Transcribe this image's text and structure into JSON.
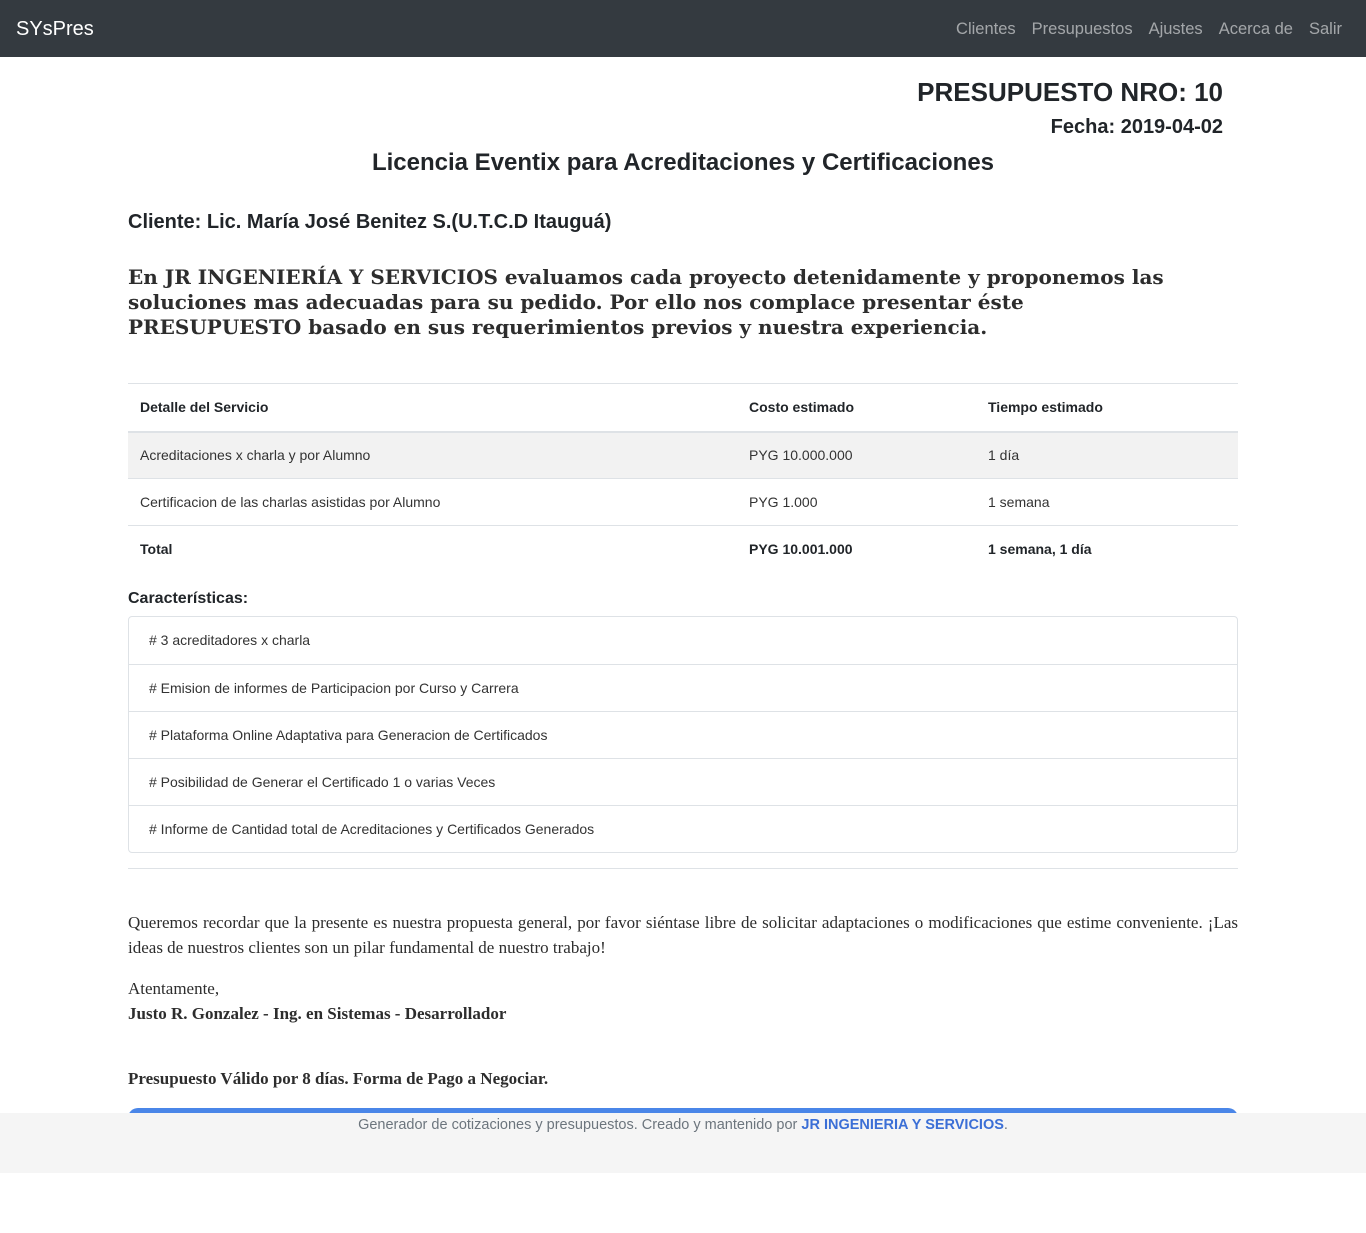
{
  "navbar": {
    "brand": "SYsPres",
    "items": [
      "Clientes",
      "Presupuestos",
      "Ajustes",
      "Acerca de",
      "Salir"
    ]
  },
  "budget": {
    "number_label": "PRESUPUESTO NRO: 10",
    "date_label": "Fecha: 2019-04-02",
    "title": "Licencia Eventix para Acreditaciones y Certificaciones",
    "client_label": "Cliente: Lic. María José Benitez S.(U.T.C.D Itauguá)",
    "intro": "En JR INGENIERÍA Y SERVICIOS evaluamos cada proyecto detenidamente y proponemos las soluciones mas adecuadas para su pedido. Por ello nos complace presentar éste PRESUPUESTO basado en sus requerimientos previos y nuestra experiencia."
  },
  "table": {
    "headers": [
      "Detalle del Servicio",
      "Costo estimado",
      "Tiempo estimado"
    ],
    "rows": [
      [
        "Acreditaciones x charla y por Alumno",
        "PYG 10.000.000",
        "1 día"
      ],
      [
        "Certificacion de las charlas asistidas por Alumno",
        "PYG 1.000",
        "1 semana"
      ]
    ],
    "total": [
      "Total",
      "PYG 10.001.000",
      "1 semana, 1 día"
    ]
  },
  "features": {
    "heading": "Características:",
    "items": [
      "# 3 acreditadores x charla",
      "# Emision de informes de Participacion por Curso y Carrera",
      "# Plataforma Online Adaptativa para Generacion de Certificados",
      "# Posibilidad de Generar el Certificado 1 o varias Veces",
      "# Informe de Cantidad total de Acreditaciones y Certificados Generados"
    ]
  },
  "closing": {
    "reminder": "Queremos recordar que la presente es nuestra propuesta general, por favor siéntase libre de solicitar adaptaciones o modificaciones que estime conveniente. ¡Las ideas de nuestros clientes son un pilar fundamental de nuestro trabajo!",
    "regards": "Atentamente,",
    "signature": "Justo R. Gonzalez - Ing. en Sistemas - Desarrollador",
    "validity": "Presupuesto Válido por 8 días. Forma de Pago a Negociar."
  },
  "footer": {
    "text": "Generador de cotizaciones y presupuestos. Creado y mantenido por ",
    "link": "JR INGENIERIA Y SERVICIOS",
    "end": "."
  },
  "colors": {
    "navbar_bg": "#343a40",
    "link": "#3b6fd6",
    "footer_bg": "#f5f5f5"
  }
}
